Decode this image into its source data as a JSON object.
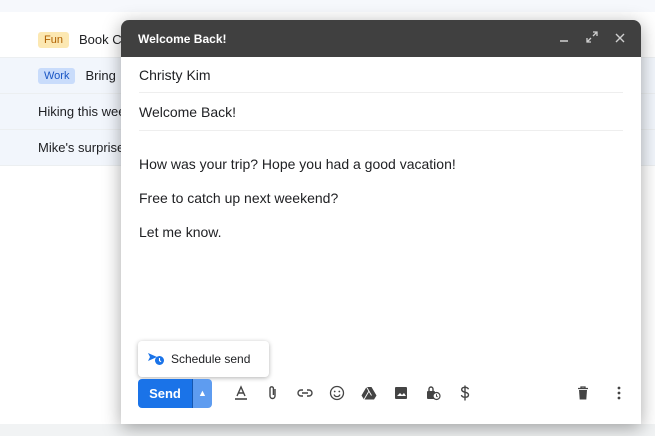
{
  "inbox": {
    "rows": [
      {
        "label": "Fun",
        "label_color": "#fce8b2",
        "text": "Book C"
      },
      {
        "label": "Work",
        "label_color": "#c9dcfb",
        "text": "Bring"
      },
      {
        "label": "",
        "text": "Hiking this wee"
      },
      {
        "label": "",
        "text": "Mike's surprise"
      }
    ]
  },
  "compose": {
    "title": "Welcome Back!",
    "recipient": "Christy Kim",
    "subject": "Welcome Back!",
    "body": [
      "How was your trip? Hope you had a good vacation!",
      "Free to catch up next weekend?",
      "Let me know."
    ],
    "schedule_send_label": "Schedule send",
    "send_label": "Send",
    "accent": "#1a73e8",
    "header_icons": [
      "minimize-icon",
      "fullscreen-icon",
      "close-icon"
    ],
    "toolbar_icons": [
      "formatting-icon",
      "attach-icon",
      "link-icon",
      "emoji-icon",
      "drive-icon",
      "photo-icon",
      "confidential-icon",
      "money-icon"
    ],
    "toolbar_right_icons": [
      "discard-icon",
      "more-options-icon"
    ]
  }
}
